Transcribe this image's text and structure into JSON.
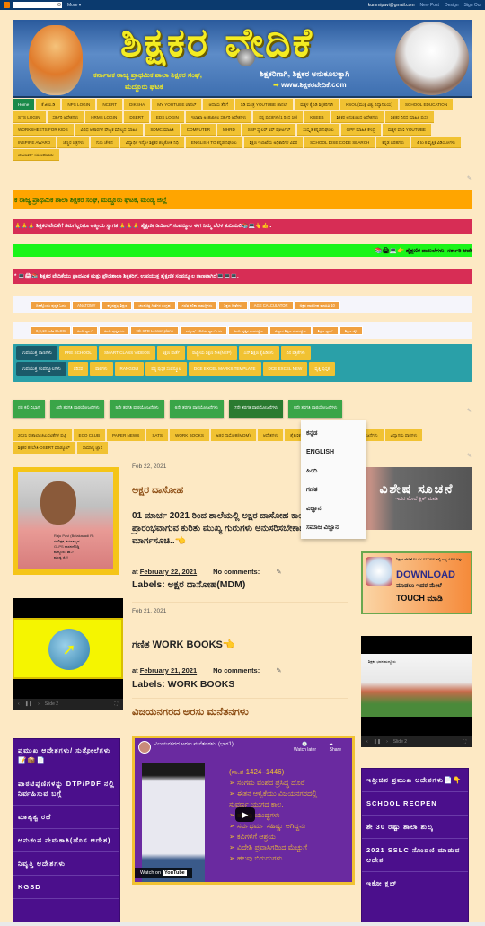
{
  "topbar": {
    "more_label": "More ▾",
    "email": "kummipavi@gmail.com",
    "links": [
      "New Post",
      "Design",
      "Sign Out"
    ]
  },
  "header": {
    "title": "ಶಿಕ್ಷಕರ ವೇದಿಕೆ",
    "subtitle_left": "ಕರ್ನಾಟಕ ರಾಜ್ಯ ಪ್ರಾಥಮಿಕ ಶಾಲಾ ಶಿಕ್ಷಕರ ಸಂಘ,",
    "subtitle_left_2": "ಮದ್ದೂರು ಘಟಕ",
    "tagline": "ಶಿಕ್ಷಕರಿಗಾಗಿ, ಶಿಕ್ಷಕರ ಅನುಕೂಲಕ್ಕಾಗಿ",
    "url": "www.ಶಿಕ್ಷಕರವೇದಿಕೆ.com"
  },
  "nav": {
    "items": [
      "Home",
      "ಕೆ.ಜಿ.ಐ.ಡಿ",
      "NPS LOGIN",
      "NCERT",
      "DIKSHA",
      "MY YOUTUBE ಚಾನಲ್",
      "ಆದಾಯ ತೆರಿಗೆ",
      "ಸಿಡಿ ಮಂತ್ರ YOUTUBE ಚಾನಲ್",
      "ಮಕ್ಕಳ ಕೈಪಿಡಿ ಶಿಕ್ಷಕರಿಗಾಗಿ",
      "KSOU(ಮುಕ್ತ ವಿಶ್ವ ವಿದ್ಯಾನಿಲಯ)",
      "SCHOOL EDUCATION",
      "STS LOGIN",
      "ಸರ್ಕಾರಿ ಆದೇಶಗಳು",
      "HRMS LOGIN",
      "DSERT",
      "EDS LOGIN",
      "ಇಲಾಖಾ ಅಂತರ್ಜಾಲ ಸರ್ಕಾರಿ ಆದೇಶಗಳು",
      "ಪಠ್ಯ ಪುಸ್ತಕಗಳು(1 ರಿಂದ 10)",
      "KSEEB",
      "ಶಿಕ್ಷಕರ ಅನುಕೂಲದ ಆದೇಶಗಳು",
      "ಶಿಕ್ಷಕರ ದಿನದ ಮಾಹಿತಿ ಪುಸ್ತಕ",
      "WORKSHEETS FOR KIDS",
      "ವಿವಿಧ ಆಹಾರಗಳ ಪೌಷ್ಟಿಕ ಮೌಲ್ಯದ ಮಾಹಿತಿ",
      "SDMC ಮಾಹಿತಿ",
      "COMPUTER",
      "MHRD",
      "SSP ಸ್ಕಾಲರ್ ಶಿಪ್ ಪೋರ್ಟಲ್",
      "ಸಂಸ್ಕೃತ ಕನ್ನಡ ನಿಘಂಟು",
      "GPF ಮಾಹಿತಿ ಕೇಂದ್ರ",
      "ಮಕ್ಕಳ ವಾಣಿ YOUTUBE",
      "INSPIRE AWARD",
      "ಚಿಣ್ಣರ ಚಿತ್ರಗಳು",
      "ಗುರು ಚೇತನ",
      "ವಿದ್ಯಾರ್ಥಿ ಇನ್ಫೋ ಶಿಕ್ಷಕರ ಶಬ್ದಕೋಶ ನಿಧಿ",
      "ENGLISH TO ಕನ್ನಡ ನಿಘಂಟು",
      "ಶಿಕ್ಷಣ ಇಲಾಖೆಯ ಅಧಿಕಾರಿಗಳ ವಿವರ",
      "SCHOOL DISE CODE SEARCH",
      "ಕನ್ನಡ ಬರಹಗಳು",
      "4 to 8 ವೃತ್ತಿಕ ವಿಡಿಯೋಗಳು",
      "ಜಯಪಾಲ್ ನರಸಿಂಹರಾಜು"
    ]
  },
  "banners": {
    "orange": "ಕ ರಾಜ್ಯ ಪ್ರಾಥಮಿಕ ಶಾಲಾ ಶಿಕ್ಷಕರ ಸಂಘ, ಮದ್ದೂರು ಘಟಕ, ಮಂಡ್ಯ ಜಿಲ್ಲೆ",
    "pink1": "🙏🙏🙏 ಶಿಕ್ಷಕರ ವೇದಿಕೆಗೆ ತಮಗೆಲ್ಲರಿಗೂ ಆತ್ಮೀಯ ಸ್ವಾಗತ 🙏🙏🙏 ಶೈಕ್ಷಣಿಕ ಡಿಜಿಟಲ್ ಸಂಪನ್ಮೂಲ ಈಗ ನಿಮ್ಮ ಬೆರಳ ತುದಿಯಲಿ📚💻👆👍..",
    "green": "📚🖨💻👉 ಶೈಕ್ಷಣಿಕ ದಾಖಲೆಗಳು, ಸರ್ಕಾರಿ ಆದೇ",
    "pink2": "* 💻🖨📚 ಶಿಕ್ಷಕರ ವೇದಿಕೆಯು ಪ್ರಾಥಮಿಕ ಮತ್ತು ಪ್ರೌಢಶಾಲಾ ಶಿಕ್ಷಕರಿಗೆ, ಉಪಯುಕ್ತ ಶೈಕ್ಷಣಿಕ ಸಂಪನ್ಮೂಲ ತಾಣವಾಗಿದೆ💻💻💻."
  },
  "orange_menu_1": [
    "ದಿನಕ್ಕೊಂದು ಪುಸ್ತಕ ಓದು",
    "ANATOMY",
    "ಕನ್ನಡಪ್ರಭ ಶಿಕ್ಷಣ",
    "ಚಲನಚಿತ್ರ ಗೀತೆಗಳ ಸಂಗ್ರಹ",
    "ಗಣಿತ ಕಲಿಕಾ ಸಾಮಗ್ರಿಗಳು",
    "ಶಿಕ್ಷಣ ಗೀತೆಗಳು",
    "AGE CALCULATOR",
    "ಅಕ್ಷರ ದಾಸೋಹ ಮಾಹಿತಿ 10"
  ],
  "orange_menu_2": [
    "8,9,10 ಗಣಿತ BLOG",
    "ಹಿಂದಿ ಬ್ಲಾಗ್",
    "ಹಿಂದಿ ಪುಸ್ತಕಗಳು",
    "9th STD Lesson plans",
    "ಇಂಗ್ಲೀಷ್ ಕಲಿಕೆಯ ಬ್ಲಾಗ್ ಗಳು",
    "ಹಿಂದಿ ವೃತ್ತಿಕ ಸಂಪನ್ಮೂಲ",
    "ವಿಜ್ಞಾನ ಶಿಕ್ಷಣ ಸಂಪನ್ಮೂಲ",
    "ಶಿಕ್ಷಣ ಬ್ಲಾಗ್",
    "ಶಿಕ್ಷಣ ಡೈರಿ"
  ],
  "teal": {
    "row1_head": "ಉಪಯುಕ್ತ ತಾಣಗಳು",
    "row1": [
      "PRE SCHOOL",
      "SMART CLASS VIDEOS",
      "ಶಿಕ್ಷಣ ವಾರ್ತೆ",
      "ರಾಷ್ಟ್ರೀಯ ಶಿಕ್ಷಣ ನೀತಿ(NEP)",
      "ಎನ್ ಶಿಕ್ಷಣ ಕೈಪಿಡಿಗಳು",
      "ದಿನ ಪತ್ರಿಕೆಗಳು"
    ],
    "row2_head": "ಉಪಯುಕ್ತ ಸಂಪನ್ಮೂಲಗಳು",
    "row2": [
      "ಪರಿಸರ",
      "ಪಾಠಗಳು",
      "RANGOLI",
      "ಪಠ್ಯ ಪುಸ್ತಕ ಸಂಪನ್ಮೂಲ",
      "DCE EXCEL MARKS TEMPLATE",
      "DCE EXCEL NEW",
      "ವೃತ್ತಿ ಪುಸ್ತಕ"
    ]
  },
  "green_menu": {
    "items": [
      "ನಲಿ ಕಲಿ ವಿಭಾಗ",
      "4ನೇ ತರಗತಿ ಪಾಠಯೋಜನೆಗಳು",
      "5ನೇ ತರಗತಿ ಪಾಠಯೋಜನೆಗಳು",
      "6ನೇ ತರಗತಿ ಪಾಠಯೋಜನೆಗಳು",
      "7ನೇ ತರಗತಿ ಪಾಠಯೋಜನೆಗಳು",
      "8ನೇ ತರಗತಿ ಪಾಠಯೋಜನೆಗಳು"
    ],
    "active_index": 4
  },
  "dropdown": {
    "options": [
      "ಕನ್ನಡ",
      "ENGLISH",
      "ಹಿಂದಿ",
      "ಗಣಿತ",
      "ವಿಜ್ಞಾನ",
      "ಸಮಾಜ ವಿಜ್ಞಾನ"
    ]
  },
  "labels_bar": [
    "2021 ರ ಶಾಲಾ ಚಟುವಟಿಕೆಗಳ ಪಟ್ಟಿ",
    "ECO CLUB",
    "PAPER NEWS",
    "SATS",
    "WORK BOOKS",
    "ಅಕ್ಷರ ದಾಸೋಹ(MDM)",
    "ಆದೇಶಗಳು",
    "ಶೈಕ್ಷಣಿಕ ದಿನದ ಚಟುವಟಿಕೆಗಳು 2021",
    "ಪಾಠಯೋಜನೆಗಳು",
    "ವಿದ್ಯಾಗಮ ಪಾಠಗಳು",
    "ಶಿಕ್ಷಕರ ತರಬೇತಿ-DSERT ಮಾಡ್ಯೂಲ್",
    "ಸಾಮಾನ್ಯ ಜ್ಞಾನ"
  ],
  "profile": {
    "caption": [
      "Raju Pavi (Belakavadi R)",
      "ಸಹಶಿಕ್ಷಕ, ಕರ್ಯಾಲ್ಯದ",
      "GLPS ದಾಸನದೊಡ್ಡಿ",
      "ಮದ್ದೂರು, ತಾ.//",
      "ಮಂಡ್ಯ ಜಿ.//"
    ]
  },
  "posts": [
    {
      "date": "Feb 22, 2021",
      "title": "ಅಕ್ಷರ ದಾಸೋಹ",
      "body": " 01 ಮಾರ್ಚ 2021 ರಿಂದ ಶಾಲೆಯಲ್ಲಿ ಅಕ್ಷರ ದಾಸೋಹ ಕಾರ್ಯ ಪ್ರಾರಂಭವಾಗುವ ಕುರಿತು ಮುಖ್ಯ ಗುರುಗಳು ಅನುಸರಿಸಬೇಕಾದ ಮಾರ್ಗಸೂಚಿ..👈",
      "meta_at": "at",
      "meta_date": "February 22, 2021",
      "comments": "No comments:",
      "labels": "Labels: ಅಕ್ಷರ ದಾಸೋಹ(MDM)"
    },
    {
      "date": "Feb 21, 2021",
      "title": "ಗಣಿತ WORK BOOKS👈",
      "meta_at": "at",
      "meta_date": "February 21, 2021",
      "comments": "No comments:",
      "labels": "Labels: WORK BOOKS"
    }
  ],
  "section_title": "ವಿಜಯನಗರದ ಅರಸು ಮನೆತನಗಳು",
  "video": {
    "title": "ವಿಜಯನಗರದ ಅರಸು ಮನೆತನಗಳು. (ಭಾಗ1)",
    "watch_later": "Watch later",
    "share": "Share",
    "slide_lines": [
      "(ಸಾ.ಶ 1424–1446)",
      "➢ ಸಂಗಮ ವಂಶದ ಪ್ರಸಿದ್ಧ ದೊರೆ",
      "➢ ಈತನ ಆಳ್ವಿಕೆಯು ವಿಜಯನಗರದಲ್ಲಿ",
      "  ಸುವರ್ಣ ಯುಗದ ಕಾಲ.",
      "➢ ಹಲವು ಯುದ್ಧಗಳು",
      "➢ ಸರ್ವಧರ್ಮ ಸಹಿಷ್ಣು ಆಗಿದ್ದನು",
      "➢ ಕವಿಗಳಿಗೆ ಆಶ್ರಯ",
      "➢ ವಿದೇಶಿ ಪ್ರವಾಸಿಗರಿಂದ ಮೆಚ್ಚುಗೆ",
      "➢ ಹಲವು ಬಿರುದುಗಳು"
    ],
    "watch_on": "Watch on",
    "youtube": "YouTube"
  },
  "slideshow_left": {
    "slide": "Slide 2"
  },
  "slideshow_right": {
    "slide": "Slide 2",
    "caption": "ಶಿಕ್ಷಕರ ಭವನ ಮದ್ದೂರು"
  },
  "notice": {
    "title": "ವಿಶೇಷ ಸೂಚನೆ",
    "subtitle": "ಇದರ ಮೇಲೆ ಕ್ಲಿಕ್ ಮಾಡಿ"
  },
  "playstore": {
    "line1": "ಶಿಕ್ಷಕರ ವೇದಿಕೆ PLAY STORE ನಲ್ಲಿ ಲಭ್ಯ APP ಅನ್ನು",
    "download": "DOWNLOAD",
    "line2": "ಮಾಡಲು ಇದರ ಮೇಲೆ",
    "touch": "TOUCH ಮಾಡಿ"
  },
  "left_menu": [
    "ಪ್ರಮುಖ ಆದೇಶಗಳು/ ಸುತ್ತೋಲೆಗಳು📝📦📄",
    "ಪಾಠಟಿಪ್ಪಣಿಗಳನ್ನು DTP/PDF ನಲ್ಲಿ ನಿರ್ವಹಿಸುವ ಬಗ್ಗೆ",
    "ಮಾತೃತ್ವ ರಜೆ",
    "ಅನುಕಂಪ ನೇಮಕಾತಿ(ಹೊಸ ಆದೇಶ)",
    "ನಿವೃತ್ತಿ ಆದೇಶಗಳು",
    "KGSD"
  ],
  "right_menu": [
    "ಇತ್ತೀಚಿನ ಪ್ರಮುಖ ಆದೇಶಗಳು📄👇",
    "SCHOOL REOPEN",
    "ಶೇ 30 ರಷ್ಟು ಶಾಲಾ ಶುಲ್ಕ",
    "2021 SSLC ನೊಂದಣಿ ಮಾಡುವ ಆದೇಶ",
    "ಇಕೋ ಕ್ಲಬ್"
  ]
}
